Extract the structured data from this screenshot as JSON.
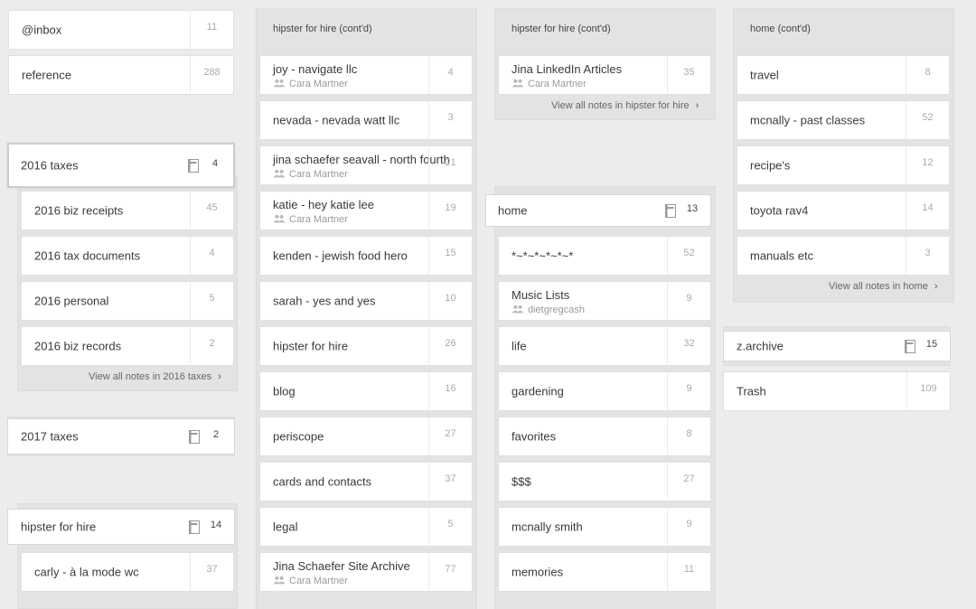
{
  "col1": {
    "inbox": {
      "name": "@inbox",
      "count": "11"
    },
    "reference": {
      "name": "reference",
      "count": "288"
    },
    "taxes2016": {
      "name": "2016 taxes",
      "count": "4"
    },
    "taxes2016_items": [
      {
        "name": "2016 biz receipts",
        "count": "45"
      },
      {
        "name": "2016 tax documents",
        "count": "4"
      },
      {
        "name": "2016 personal",
        "count": "5"
      },
      {
        "name": "2016 biz records",
        "count": "2"
      }
    ],
    "taxes2016_viewall": "View all notes in 2016 taxes",
    "taxes2017": {
      "name": "2017 taxes",
      "count": "2"
    },
    "hipster": {
      "name": "hipster for hire",
      "count": "14"
    },
    "hipster_first": {
      "name": "carly - à la mode wc",
      "count": "37"
    }
  },
  "col2": {
    "title": "hipster for hire (cont'd)",
    "items": [
      {
        "name": "joy - navigate llc",
        "owner": "Cara Martner",
        "count": "4"
      },
      {
        "name": "nevada - nevada watt llc",
        "count": "3"
      },
      {
        "name": "jina schaefer seavall - north fourth",
        "owner": "Cara Martner",
        "count": "21"
      },
      {
        "name": "katie - hey katie lee",
        "owner": "Cara Martner",
        "count": "19"
      },
      {
        "name": "kenden - jewish food hero",
        "count": "15"
      },
      {
        "name": "sarah - yes and yes",
        "count": "10"
      },
      {
        "name": "hipster for hire",
        "count": "26"
      },
      {
        "name": "blog",
        "count": "16"
      },
      {
        "name": "periscope",
        "count": "27"
      },
      {
        "name": "cards and contacts",
        "count": "37"
      },
      {
        "name": "legal",
        "count": "5"
      },
      {
        "name": "Jina Schaefer Site Archive",
        "owner": "Cara Martner",
        "count": "77"
      }
    ]
  },
  "col3": {
    "title": "hipster for hire (cont'd)",
    "top_item": {
      "name": "Jina LinkedIn Articles",
      "owner": "Cara Martner",
      "count": "35"
    },
    "viewall": "View all notes in hipster for hire",
    "home": {
      "name": "home",
      "count": "13"
    },
    "items": [
      {
        "name": "*~*~*~*~*~*",
        "count": "52"
      },
      {
        "name": "Music Lists",
        "owner": "dietgregcash",
        "count": "9"
      },
      {
        "name": "life",
        "count": "32"
      },
      {
        "name": "gardening",
        "count": "9"
      },
      {
        "name": "favorites",
        "count": "8"
      },
      {
        "name": "$$$",
        "count": "27"
      },
      {
        "name": "mcnally smith",
        "count": "9"
      },
      {
        "name": "memories",
        "count": "11"
      }
    ]
  },
  "col4": {
    "title": "home (cont'd)",
    "items": [
      {
        "name": "travel",
        "count": "8"
      },
      {
        "name": "mcnally - past classes",
        "count": "52"
      },
      {
        "name": "recipe's",
        "count": "12"
      },
      {
        "name": "toyota rav4",
        "count": "14"
      },
      {
        "name": "manuals etc",
        "count": "3"
      }
    ],
    "viewall": "View all notes in home",
    "archive": {
      "name": "z.archive",
      "count": "15"
    },
    "trash": {
      "name": "Trash",
      "count": "109"
    }
  },
  "icons": {
    "stack": "notebook-stack-icon",
    "shared": "shared-people-icon",
    "chevron": "chevron-right-icon"
  }
}
